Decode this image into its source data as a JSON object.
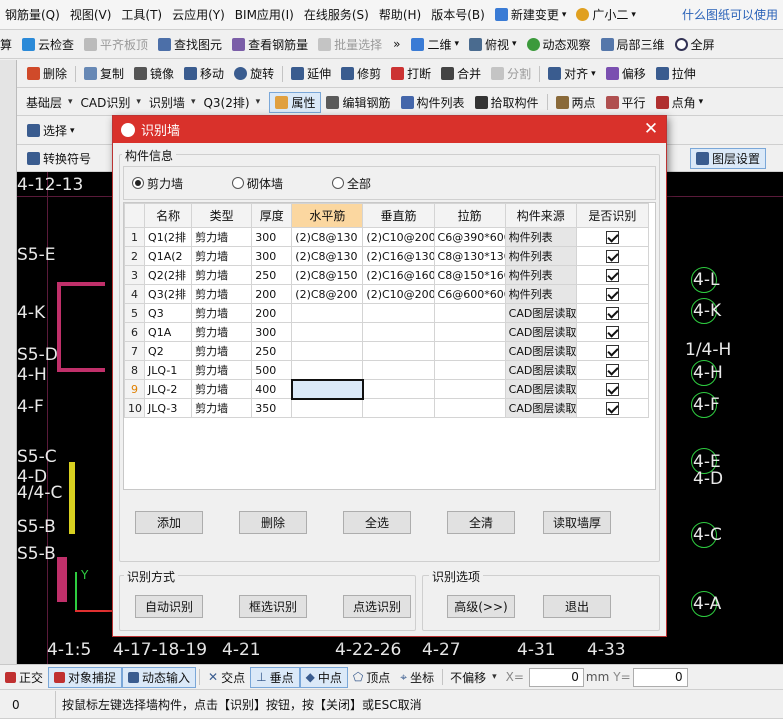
{
  "menubar": {
    "items": [
      "钢筋量(Q)",
      "视图(V)",
      "工具(T)",
      "云应用(Y)",
      "BIM应用(I)",
      "在线服务(S)",
      "帮助(H)",
      "版本号(B)"
    ],
    "new_change": "新建变更",
    "user": "广小二",
    "ad": "什么图纸可以使用"
  },
  "toolbar1": {
    "cut_label": "算",
    "cloud_check": "云检查",
    "align_slab": "平齐板顶",
    "find": "查找图元",
    "view_rebar": "查看钢筋量",
    "batch_select": "批量选择",
    "view2d": "二维",
    "view_top": "俯视",
    "dynamic": "动态观察",
    "local3d": "局部三维",
    "fullscreen": "全屏"
  },
  "toolbar2": {
    "items": [
      "删除",
      "复制",
      "镜像",
      "移动",
      "旋转",
      "延伸",
      "修剪",
      "打断",
      "合并",
      "分割",
      "对齐",
      "偏移",
      "拉伸"
    ]
  },
  "toolbar3": {
    "layer": "基础层",
    "cad": "CAD识别",
    "identify_wall": "识别墙",
    "element": "Q3(2排)",
    "property": "属性",
    "edit_rebar": "编辑钢筋",
    "component_list": "构件列表",
    "pick": "拾取构件",
    "two_point": "两点",
    "parallel": "平行",
    "point_angle": "点角"
  },
  "toolbar4": {
    "select": "选择",
    "convert": "转换符号",
    "layer_settings": "图层设置"
  },
  "dialog": {
    "title": "识别墙",
    "group_info": "构件信息",
    "radios": [
      {
        "label": "剪力墙",
        "checked": true
      },
      {
        "label": "砌体墙",
        "checked": false
      },
      {
        "label": "全部",
        "checked": false
      }
    ],
    "columns": [
      "名称",
      "类型",
      "厚度",
      "水平筋",
      "垂直筋",
      "拉筋",
      "构件来源",
      "是否识别"
    ],
    "rows": [
      {
        "n": "1",
        "name": "Q1(2排",
        "type": "剪力墙",
        "thk": "300",
        "h": "(2)C8@130",
        "v": "(2)C10@200",
        "tie": "C6@390*600",
        "src": "构件列表",
        "ok": true
      },
      {
        "n": "2",
        "name": "Q1A(2",
        "type": "剪力墙",
        "thk": "300",
        "h": "(2)C8@130",
        "v": "(2)C16@130",
        "tie": "C8@130*130",
        "src": "构件列表",
        "ok": true
      },
      {
        "n": "3",
        "name": "Q2(2排",
        "type": "剪力墙",
        "thk": "250",
        "h": "(2)C8@150",
        "v": "(2)C16@160",
        "tie": "C8@150*160",
        "src": "构件列表",
        "ok": true
      },
      {
        "n": "4",
        "name": "Q3(2排",
        "type": "剪力墙",
        "thk": "200",
        "h": "(2)C8@200",
        "v": "(2)C10@200",
        "tie": "C6@600*600",
        "src": "构件列表",
        "ok": true
      },
      {
        "n": "5",
        "name": "Q3",
        "type": "剪力墙",
        "thk": "200",
        "h": "",
        "v": "",
        "tie": "",
        "src": "CAD图层读取",
        "ok": true
      },
      {
        "n": "6",
        "name": "Q1A",
        "type": "剪力墙",
        "thk": "300",
        "h": "",
        "v": "",
        "tie": "",
        "src": "CAD图层读取",
        "ok": true
      },
      {
        "n": "7",
        "name": "Q2",
        "type": "剪力墙",
        "thk": "250",
        "h": "",
        "v": "",
        "tie": "",
        "src": "CAD图层读取",
        "ok": true
      },
      {
        "n": "8",
        "name": "JLQ-1",
        "type": "剪力墙",
        "thk": "500",
        "h": "",
        "v": "",
        "tie": "",
        "src": "CAD图层读取",
        "ok": true
      },
      {
        "n": "9",
        "name": "JLQ-2",
        "type": "剪力墙",
        "thk": "400",
        "h": "",
        "v": "",
        "tie": "",
        "src": "CAD图层读取",
        "ok": true
      },
      {
        "n": "10",
        "name": "JLQ-3",
        "type": "剪力墙",
        "thk": "350",
        "h": "",
        "v": "",
        "tie": "",
        "src": "CAD图层读取",
        "ok": true
      }
    ],
    "btn_add": "添加",
    "btn_delete": "删除",
    "btn_select_all": "全选",
    "btn_clear": "全清",
    "btn_read_thk": "读取墙厚",
    "group_method": "识别方式",
    "btn_auto": "自动识别",
    "btn_box": "框选识别",
    "btn_point": "点选识别",
    "group_options": "识别选项",
    "btn_advanced": "高级(>>)",
    "btn_exit": "退出"
  },
  "canvas": {
    "left_labels": [
      "4-12-13",
      "S5-E",
      "4-K",
      "S5-D",
      "4-H",
      "4-F",
      "S5-C",
      "4-D",
      "4/4-C",
      "S5-B",
      "S5-B"
    ],
    "right_labels": [
      "4-L",
      "4-K",
      "1/4-H",
      "4-H",
      "4-F",
      "4-E",
      "4-D",
      "4-C",
      "4-A"
    ],
    "bottom_labels": [
      "4-1:5",
      "4-17-18-19",
      "4-21",
      "4-22-26",
      "4-27",
      "4-31",
      "4-33"
    ],
    "axis_y": "Y",
    "axis_x": "X"
  },
  "statusbar": {
    "ortho": "正交",
    "snap": "对象捕捉",
    "dyn_input": "动态输入",
    "intersect": "交点",
    "perp": "垂点",
    "mid": "中点",
    "vertex": "顶点",
    "coord": "坐标",
    "offset": "不偏移",
    "x_label": "X=",
    "x_val": "0",
    "unit": "mm",
    "y_label": "Y=",
    "y_val": "0"
  },
  "hint": {
    "num": "0",
    "text": "按鼠标左键选择墙构件，点击【识别】按钮，按【关闭】或ESC取消"
  },
  "colors": {
    "title_red": "#d9312b",
    "canvas": "#000000",
    "axis_green": "#2ecc40",
    "grid_magenta": "#c0306a"
  }
}
